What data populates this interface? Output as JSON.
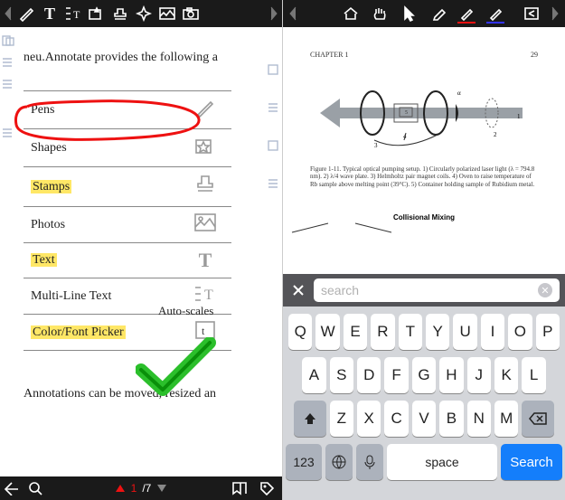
{
  "left": {
    "toolbar": [
      {
        "name": "back-nav-icon"
      },
      {
        "name": "pen-icon"
      },
      {
        "name": "text-icon",
        "label": "T"
      },
      {
        "name": "multiline-text-icon"
      },
      {
        "name": "shape-icon"
      },
      {
        "name": "stamp-icon"
      },
      {
        "name": "pointer-icon"
      },
      {
        "name": "photo-icon"
      },
      {
        "name": "camera-icon"
      },
      {
        "name": "forward-nav-icon"
      }
    ],
    "intro": "neu.Annotate provides the following a",
    "rows": [
      {
        "label": "Pens",
        "icon": "pencil-icon",
        "highlight": false
      },
      {
        "label": "Shapes",
        "icon": "star-box-icon",
        "highlight": false
      },
      {
        "label": "Stamps",
        "icon": "stamp-icon",
        "highlight": true
      },
      {
        "label": "Photos",
        "icon": "image-icon",
        "highlight": false
      },
      {
        "label": "Text",
        "icon": "text-t-icon",
        "highlight": true
      },
      {
        "label": "Multi-Line Text",
        "icon": "multiline-t-icon",
        "highlight": false
      },
      {
        "label": "Color/Font Picker",
        "icon": "picker-icon",
        "highlight": true
      }
    ],
    "autoscales": "Auto-scales",
    "footnote": "Annotations can be moved, resized an",
    "page_current": "1",
    "page_total": "/7"
  },
  "right": {
    "chapter": "CHAPTER 1",
    "page_no": "29",
    "caption": "Figure 1-11. Typical optical pumping setup. 1) Circularly polarized laser light (λ = 794.8 nm). 2) λ/4 wave plate. 3) Helmholtz pair magnet coils. 4) Oven to raise temperature of Rb sample above melting point (39°C). 5) Container holding sample of Rubidium metal.",
    "mixing": "Collisional Mixing",
    "search_value": "search",
    "keyboard": {
      "row1": [
        "Q",
        "W",
        "E",
        "R",
        "T",
        "Y",
        "U",
        "I",
        "O",
        "P"
      ],
      "row2": [
        "A",
        "S",
        "D",
        "F",
        "G",
        "H",
        "J",
        "K",
        "L"
      ],
      "row3": [
        "Z",
        "X",
        "C",
        "V",
        "B",
        "N",
        "M"
      ],
      "num": "123",
      "space": "space",
      "search": "Search"
    }
  }
}
